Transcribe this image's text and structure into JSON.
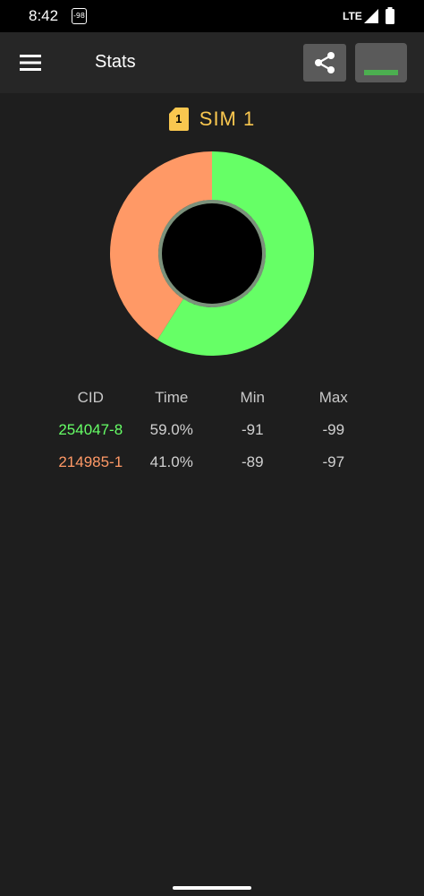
{
  "status_bar": {
    "time": "8:42",
    "badge": "-98",
    "network": "LTE"
  },
  "app_bar": {
    "title": "Stats",
    "menu_icon": "menu-icon",
    "share_icon": "share-icon"
  },
  "sim": {
    "badge_number": "1",
    "title": "SIM 1",
    "color": "#f9c74f"
  },
  "chart_data": {
    "type": "pie",
    "donut": true,
    "slices": [
      {
        "label": "254047-8",
        "value": 59.0,
        "color": "#66ff66"
      },
      {
        "label": "214985-1",
        "value": 41.0,
        "color": "#ff9966"
      }
    ]
  },
  "table": {
    "headers": [
      "CID",
      "Time",
      "Min",
      "Max"
    ],
    "rows": [
      {
        "cid": "254047-8",
        "time": "59.0%",
        "min": "-91",
        "max": "-99",
        "color": "#66ff66"
      },
      {
        "cid": "214985-1",
        "time": "41.0%",
        "min": "-89",
        "max": "-97",
        "color": "#ff9966"
      }
    ]
  }
}
